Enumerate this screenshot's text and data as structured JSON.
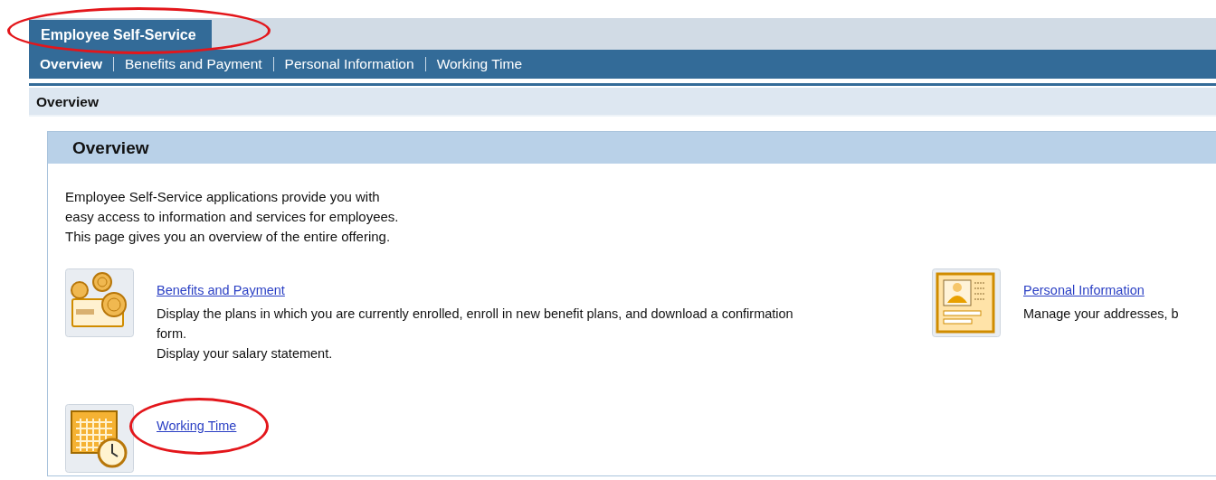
{
  "header": {
    "tab": {
      "label": "Employee Self-Service",
      "selected": true,
      "highlighted": true
    },
    "nav": [
      {
        "label": "Overview",
        "selected": true
      },
      {
        "label": "Benefits and Payment",
        "selected": false
      },
      {
        "label": "Personal Information",
        "selected": false
      },
      {
        "label": "Working Time",
        "selected": false
      }
    ]
  },
  "breadcrumb": "Overview",
  "panel": {
    "title": "Overview",
    "intro": [
      "Employee Self-Service applications provide you with",
      "easy access to information and services for employees.",
      "This page gives you an overview of the entire offering."
    ],
    "services": [
      {
        "kind": "money",
        "title": "Benefits and Payment",
        "highlighted": false,
        "description": [
          "Display the plans in which you are currently enrolled, enroll in new benefit plans, and download a confirmation form.",
          "Display your salary statement."
        ]
      },
      {
        "kind": "person",
        "title": "Personal Information",
        "highlighted": false,
        "description": [
          "Manage your addresses, b"
        ]
      },
      {
        "kind": "time",
        "title": "Working Time",
        "highlighted": true
      }
    ]
  }
}
